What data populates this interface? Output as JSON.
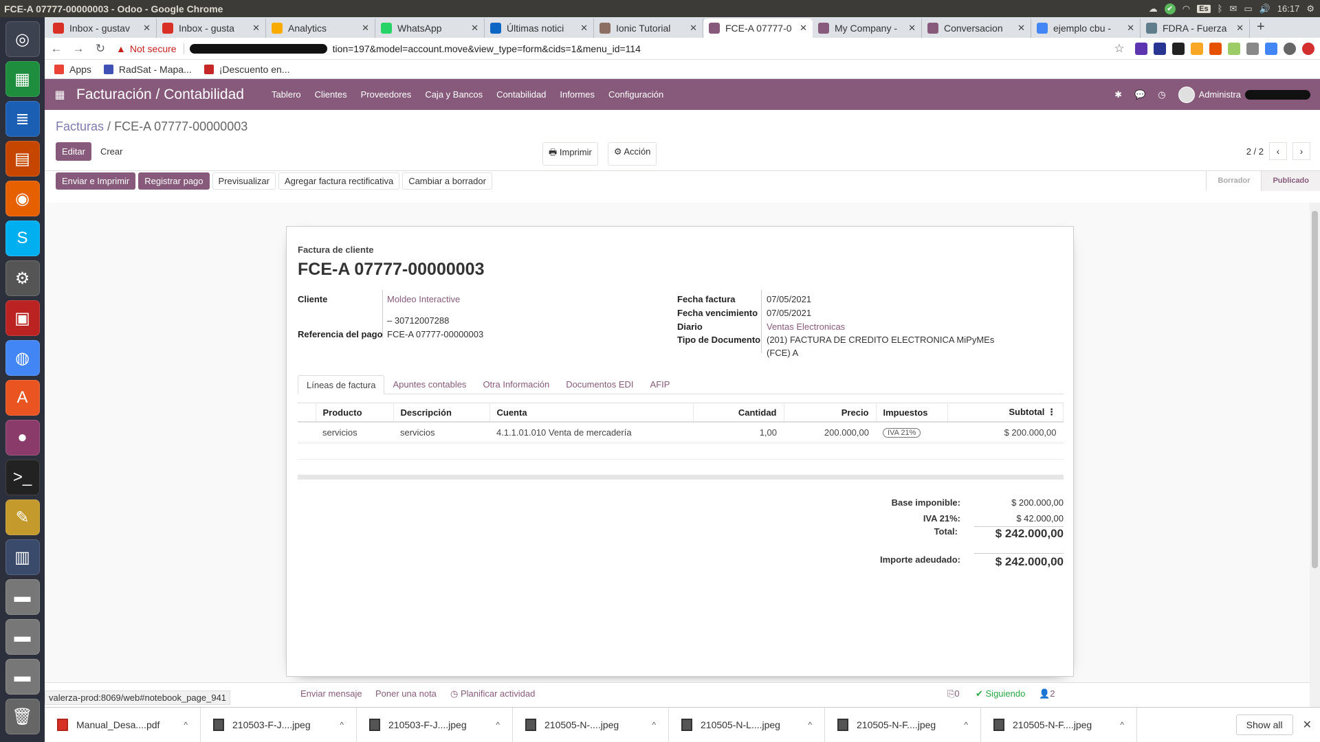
{
  "os": {
    "window_title": "FCE-A 07777-00000003 - Odoo - Google Chrome",
    "clock": "16:17",
    "lang_indicator": "Es"
  },
  "browser": {
    "tabs": [
      {
        "label": "Inbox - gustav",
        "color": "#d93025"
      },
      {
        "label": "Inbox - gusta",
        "color": "#d93025"
      },
      {
        "label": "Analytics",
        "color": "#f9ab00"
      },
      {
        "label": "WhatsApp",
        "color": "#25d366"
      },
      {
        "label": "Últimas notici",
        "color": "#0a66c2"
      },
      {
        "label": "Ionic Tutorial",
        "color": "#8d6e63"
      },
      {
        "label": "FCE-A 07777-0",
        "color": "#875a7b",
        "active": true
      },
      {
        "label": "My Company -",
        "color": "#875a7b"
      },
      {
        "label": "Conversacion",
        "color": "#875a7b"
      },
      {
        "label": "ejemplo cbu -",
        "color": "#4285f4"
      },
      {
        "label": "FDRA - Fuerza",
        "color": "#607d8b"
      }
    ],
    "not_secure": "Not secure",
    "url_suffix": "tion=197&model=account.move&view_type=form&cids=1&menu_id=114",
    "bookmarks": [
      {
        "label": "Apps",
        "color": "#ea4335"
      },
      {
        "label": "RadSat - Mapa...",
        "color": "#3f51b5"
      },
      {
        "label": "¡Descuento en...",
        "color": "#c62828"
      }
    ]
  },
  "odoo": {
    "brand": "Facturación / Contabilidad",
    "menu": [
      "Tablero",
      "Clientes",
      "Proveedores",
      "Caja y Bancos",
      "Contabilidad",
      "Informes",
      "Configuración"
    ],
    "user": "Administra",
    "breadcrumb": {
      "parent": "Facturas",
      "separator": "/",
      "current": "FCE-A 07777-00000003"
    },
    "buttons": {
      "edit": "Editar",
      "create": "Crear",
      "print": "Imprimir",
      "action": "Acción"
    },
    "pager": "2 / 2",
    "header_buttons": [
      "Enviar e Imprimir",
      "Registrar pago",
      "Previsualizar",
      "Agregar factura rectificativa",
      "Cambiar a borrador"
    ],
    "stages": {
      "draft": "Borrador",
      "posted": "Publicado"
    },
    "invoice": {
      "doc_type": "Factura de cliente",
      "name": "FCE-A 07777-00000003",
      "customer_label": "Cliente",
      "customer": "Moldeo Interactive",
      "customer_vat": "– 30712007288",
      "payment_ref_label": "Referencia del pago",
      "payment_ref": "FCE-A 07777-00000003",
      "invoice_date_label": "Fecha factura",
      "invoice_date": "07/05/2021",
      "due_date_label": "Fecha vencimiento",
      "due_date": "07/05/2021",
      "journal_label": "Diario",
      "journal": "Ventas Electronicas",
      "doc_type_label": "Tipo de Documento",
      "doc_type_value_1": "(201) FACTURA DE CREDITO ELECTRONICA MiPyMEs",
      "doc_type_value_2": "(FCE) A"
    },
    "notebook_tabs": [
      "Líneas de factura",
      "Apuntes contables",
      "Otra Información",
      "Documentos EDI",
      "AFIP"
    ],
    "lines_table": {
      "columns": [
        "Producto",
        "Descripción",
        "Cuenta",
        "Cantidad",
        "Precio",
        "Impuestos",
        "Subtotal"
      ],
      "rows": [
        {
          "product": "servicios",
          "description": "servicios",
          "account": "4.1.1.01.010 Venta de mercadería",
          "qty": "1,00",
          "price": "200.000,00",
          "tax": "IVA 21%",
          "subtotal": "$ 200.000,00"
        }
      ]
    },
    "totals": {
      "base_label": "Base imponible:",
      "base": "$ 200.000,00",
      "iva_label": "IVA 21%:",
      "iva": "$ 42.000,00",
      "total_label": "Total:",
      "total": "$ 242.000,00",
      "due_label": "Importe adeudado:",
      "due": "$ 242.000,00"
    },
    "chatter": {
      "send_message": "Enviar mensaje",
      "log_note": "Poner una nota",
      "schedule": "Planificar actividad",
      "attachments": "0",
      "following": "Siguiendo",
      "followers": "2"
    },
    "status_url": "valerza-prod:8069/web#notebook_page_941"
  },
  "downloads": {
    "items": [
      "Manual_Desa....pdf",
      "210503-F-J....jpeg",
      "210503-F-J....jpeg",
      "210505-N-....jpeg",
      "210505-N-L....jpeg",
      "210505-N-F....jpeg",
      "210505-N-F....jpeg"
    ],
    "show_all": "Show all"
  }
}
